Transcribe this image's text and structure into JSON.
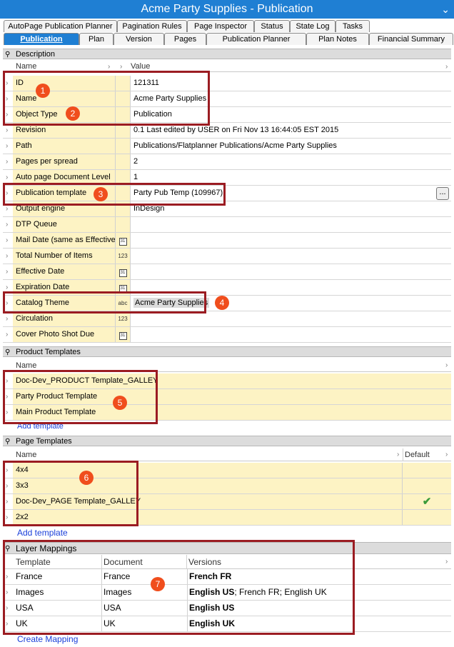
{
  "window": {
    "title": "Acme Party Supplies - Publication"
  },
  "tabs_row1": [
    {
      "label": "AutoPage Publication Planner"
    },
    {
      "label": "Pagination Rules"
    },
    {
      "label": "Page Inspector"
    },
    {
      "label": "Status"
    },
    {
      "label": "State Log"
    },
    {
      "label": "Tasks"
    }
  ],
  "tabs_row2": [
    {
      "label": "Publication"
    },
    {
      "label": "Plan"
    },
    {
      "label": "Version"
    },
    {
      "label": "Pages"
    },
    {
      "label": "Publication Planner"
    },
    {
      "label": "Plan Notes"
    },
    {
      "label": "Financial Summary"
    }
  ],
  "description": {
    "section_label": "Description",
    "col_name": "Name",
    "col_value": "Value",
    "rows": [
      {
        "name": "ID",
        "value": "121311"
      },
      {
        "name": "Name",
        "value": "Acme Party Supplies"
      },
      {
        "name": "Object Type",
        "value": "Publication"
      },
      {
        "name": "Revision",
        "value": "0.1 Last edited by USER on Fri Nov 13 16:44:05 EST 2015"
      },
      {
        "name": "Path",
        "value": "Publications/Flatplanner Publications/Acme Party Supplies"
      },
      {
        "name": "Pages per spread",
        "value": "2"
      },
      {
        "name": "Auto page Document Level",
        "value": "1"
      },
      {
        "name": "Publication template",
        "value": "Party Pub Temp (109967)"
      },
      {
        "name": "Output engine",
        "value": "InDesign"
      },
      {
        "name": "DTP Queue",
        "value": ""
      },
      {
        "name": "Mail Date (same as Effective",
        "value": ""
      },
      {
        "name": "Total Number of Items",
        "value": ""
      },
      {
        "name": "Effective Date",
        "value": ""
      },
      {
        "name": "Expiration Date",
        "value": ""
      },
      {
        "name": "Catalog Theme",
        "value": "Acme Party Supplies"
      },
      {
        "name": "Circulation",
        "value": ""
      },
      {
        "name": "Cover Photo Shot Due",
        "value": ""
      }
    ],
    "ellipsis_label": "..."
  },
  "type_icons": {
    "number": "123",
    "text": "abc",
    "date": "31"
  },
  "product_templates": {
    "section_label": "Product Templates",
    "col_name": "Name",
    "rows": [
      {
        "name": "Doc-Dev_PRODUCT Template_GALLEY"
      },
      {
        "name": "Party Product Template"
      },
      {
        "name": "Main Product Template"
      }
    ],
    "add_link": "Add template"
  },
  "page_templates": {
    "section_label": "Page Templates",
    "col_name": "Name",
    "col_default": "Default",
    "rows": [
      {
        "name": "4x4",
        "default": ""
      },
      {
        "name": "3x3",
        "default": ""
      },
      {
        "name": "Doc-Dev_PAGE Template_GALLEY",
        "default": "✔"
      },
      {
        "name": "2x2",
        "default": ""
      }
    ],
    "add_link": "Add template"
  },
  "layer_mappings": {
    "section_label": "Layer Mappings",
    "col_template": "Template",
    "col_document": "Document",
    "col_versions": "Versions",
    "rows": [
      {
        "template": "France",
        "document": "France",
        "versions_bold": "French FR",
        "versions_rest": ""
      },
      {
        "template": "Images",
        "document": "Images",
        "versions_bold": "English US",
        "versions_rest": "; French FR; English UK"
      },
      {
        "template": "USA",
        "document": "USA",
        "versions_bold": "English US",
        "versions_rest": ""
      },
      {
        "template": "UK",
        "document": "UK",
        "versions_bold": "English UK",
        "versions_rest": ""
      }
    ],
    "create_link": "Create Mapping"
  },
  "annotations": {
    "b1": "1",
    "b2": "2",
    "b3": "3",
    "b4": "4",
    "b5": "5",
    "b6": "6",
    "b7": "7"
  },
  "colors": {
    "title_bar": "#1f7fd3",
    "row_highlight": "#fdf3c4",
    "annotation_box": "#9b1c22",
    "annotation_badge": "#f04e1d",
    "link": "#1a3fd9"
  },
  "glyphs": {
    "chevron_right": "›",
    "pin": "⚲",
    "chevron_down": "⌄"
  }
}
